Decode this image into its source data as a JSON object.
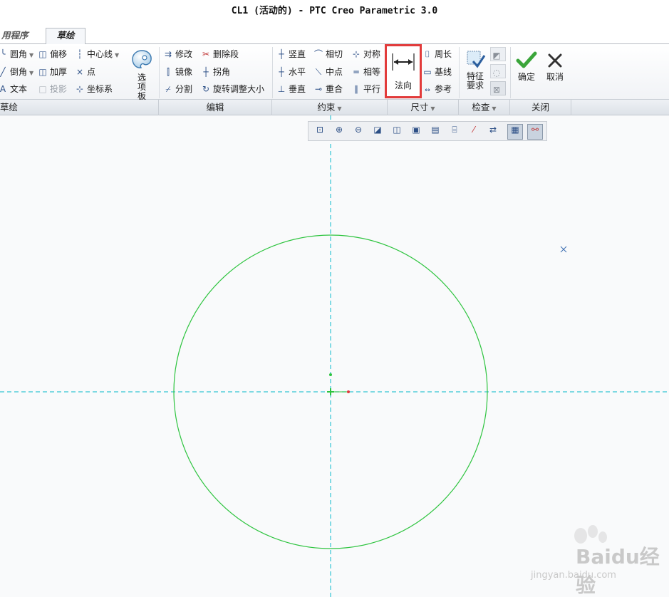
{
  "window": {
    "title": "CL1 (活动的) - PTC Creo Parametric 3.0"
  },
  "tabs": [
    {
      "label": "用程序"
    },
    {
      "label": "草绘"
    }
  ],
  "ribbon": {
    "sketch": {
      "fillet": "圆角",
      "chamfer": "倒角",
      "text": "文本",
      "offset": "偏移",
      "thicken": "加厚",
      "project": "投影",
      "centerline": "中心线",
      "point": "点",
      "coordsys": "坐标系",
      "palette": "选项板"
    },
    "edit": {
      "modify": "修改",
      "delete_segment": "删除段",
      "mirror": "镜像",
      "corner": "拐角",
      "divide": "分割",
      "rotate_resize": "旋转调整大小"
    },
    "constrain": {
      "vertical": "竖直",
      "tangent": "相切",
      "symmetric": "对称",
      "horizontal": "水平",
      "midpoint": "中点",
      "equal": "相等",
      "perpendicular": "垂直",
      "coincident": "重合",
      "parallel": "平行"
    },
    "dimension": {
      "normal": "法向",
      "perimeter": "周长",
      "baseline": "基线",
      "reference": "参考"
    },
    "inspect": {
      "feature_requirements": "特征\n要求"
    },
    "close": {
      "ok": "确定",
      "cancel": "取消"
    }
  },
  "groups": {
    "sketch": "草绘",
    "edit": "编辑",
    "constrain": "约束",
    "dimension": "尺寸",
    "inspect": "检查",
    "close": "关闭"
  },
  "watermark": {
    "logo": "Baidu经验",
    "url": "jingyan.baidu.com"
  },
  "colors": {
    "sketch_entity": "#2ec43f",
    "centerline": "#34c5d4",
    "highlight_box": "#e23b3b",
    "ok_check": "#3aa53a"
  }
}
